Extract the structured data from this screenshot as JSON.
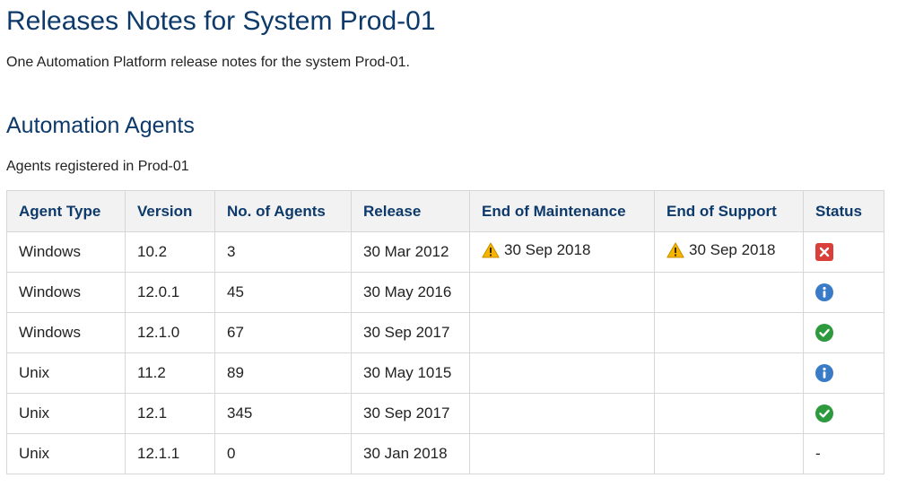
{
  "page": {
    "title": "Releases Notes for System Prod-01",
    "description": "One Automation Platform release notes for the system Prod-01."
  },
  "section": {
    "title": "Automation Agents",
    "description": "Agents registered in Prod-01"
  },
  "table": {
    "columns": [
      "Agent Type",
      "Version",
      "No. of Agents",
      "Release",
      "End of Maintenance",
      "End of Support",
      "Status"
    ],
    "rows": [
      {
        "agent_type": "Windows",
        "version": "10.2",
        "agents": "3",
        "release": "30 Mar 2012",
        "end_of_maintenance": "30 Sep 2018",
        "end_of_support": "30 Sep 2018",
        "status": "error",
        "status_text": ""
      },
      {
        "agent_type": "Windows",
        "version": "12.0.1",
        "agents": "45",
        "release": "30 May 2016",
        "end_of_maintenance": "",
        "end_of_support": "",
        "status": "info",
        "status_text": ""
      },
      {
        "agent_type": "Windows",
        "version": "12.1.0",
        "agents": "67",
        "release": "30 Sep 2017",
        "end_of_maintenance": "",
        "end_of_support": "",
        "status": "ok",
        "status_text": ""
      },
      {
        "agent_type": "Unix",
        "version": "11.2",
        "agents": "89",
        "release": "30 May 1015",
        "end_of_maintenance": "",
        "end_of_support": "",
        "status": "info",
        "status_text": ""
      },
      {
        "agent_type": "Unix",
        "version": "12.1",
        "agents": "345",
        "release": "30 Sep 2017",
        "end_of_maintenance": "",
        "end_of_support": "",
        "status": "ok",
        "status_text": ""
      },
      {
        "agent_type": "Unix",
        "version": "12.1.1",
        "agents": "0",
        "release": "30 Jan 2018",
        "end_of_maintenance": "",
        "end_of_support": "",
        "status": "none",
        "status_text": "-"
      }
    ]
  },
  "icons": {
    "warning": "warning-icon",
    "error": "error-icon",
    "info": "info-icon",
    "ok": "check-icon"
  },
  "colors": {
    "heading": "#0d3a6b",
    "header_bg": "#f2f2f2",
    "border": "#d6d6d6",
    "warning": "#f5b400",
    "error": "#d9403a",
    "info": "#3a7bc8",
    "ok": "#2e9a3e"
  }
}
